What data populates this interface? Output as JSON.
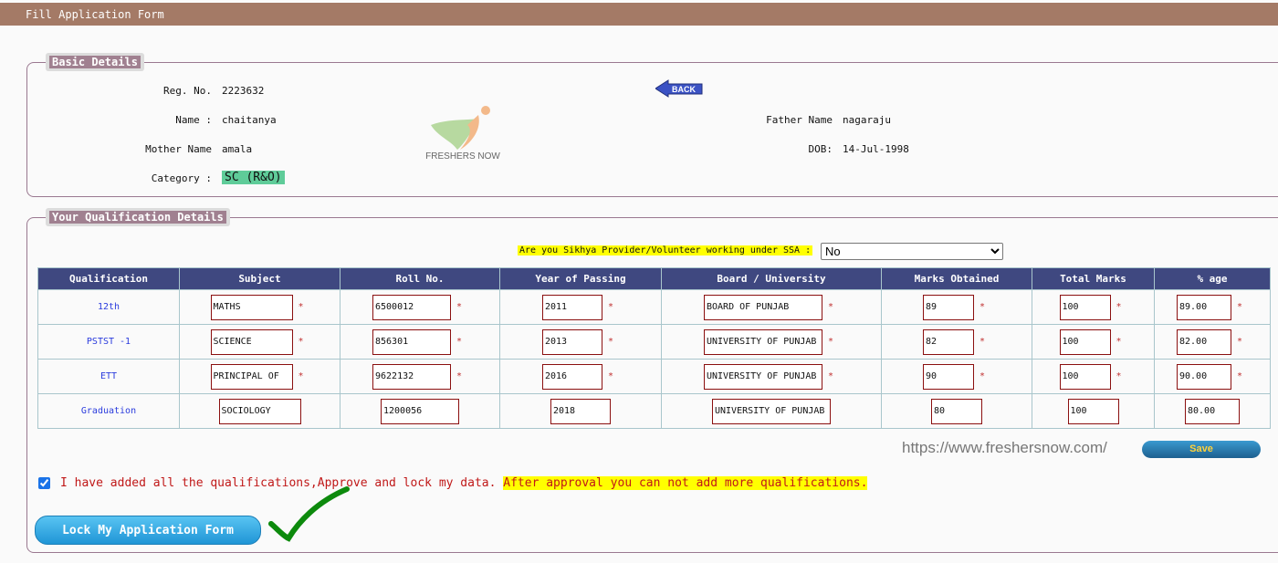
{
  "header": {
    "title": "Fill Application Form"
  },
  "basic": {
    "legend": "Basic Details",
    "reg_label": "Reg. No.",
    "reg": "2223632",
    "name_label": "Name :",
    "name": "chaitanya",
    "father_label": "Father Name",
    "father": "nagaraju",
    "mother_label": "Mother Name",
    "mother": "amala",
    "dob_label": "DOB:",
    "dob": "14-Jul-1998",
    "category_label": "Category :",
    "category": "SC (R&O)",
    "back": "BACK",
    "logo_text": "FRESHERS NOW"
  },
  "qual": {
    "legend": "Your Qualification Details",
    "ssa_label": "Are you Sikhya Provider/Volunteer working under SSA :",
    "ssa_value": "No",
    "columns": [
      "Qualification",
      "Subject",
      "Roll No.",
      "Year of Passing",
      "Board / University",
      "Marks Obtained",
      "Total Marks",
      "% age"
    ],
    "rows": [
      {
        "q": "12th",
        "cells": [
          "MATHS",
          "6500012",
          "2011",
          "BOARD OF PUNJAB",
          "89",
          "100",
          "89.00"
        ],
        "required": true
      },
      {
        "q": "PSTST -1",
        "cells": [
          "SCIENCE",
          "856301",
          "2013",
          "UNIVERSITY OF PUNJAB",
          "82",
          "100",
          "82.00"
        ],
        "required": true
      },
      {
        "q": "ETT",
        "cells": [
          "PRINCIPAL OF",
          "9622132",
          "2016",
          "UNIVERSITY OF PUNJAB",
          "90",
          "100",
          "90.00"
        ],
        "required": true
      },
      {
        "q": "Graduation",
        "cells": [
          "SOCIOLOGY",
          "1200056",
          "2018",
          "UNIVERSITY OF PUNJAB",
          "80",
          "100",
          "80.00"
        ],
        "required": false
      }
    ]
  },
  "watermark": "https://www.freshersnow.com/",
  "save": "Save",
  "agree": {
    "checked": true,
    "text": "I have added all the qualifications,Approve and lock my data.",
    "warning": "After approval you can not add more qualifications."
  },
  "lock": "Lock My Application Form",
  "colors": {
    "header": "#a47a66",
    "table_header": "#3f4880",
    "category": "#5fcc99",
    "highlight": "#ffff00"
  }
}
